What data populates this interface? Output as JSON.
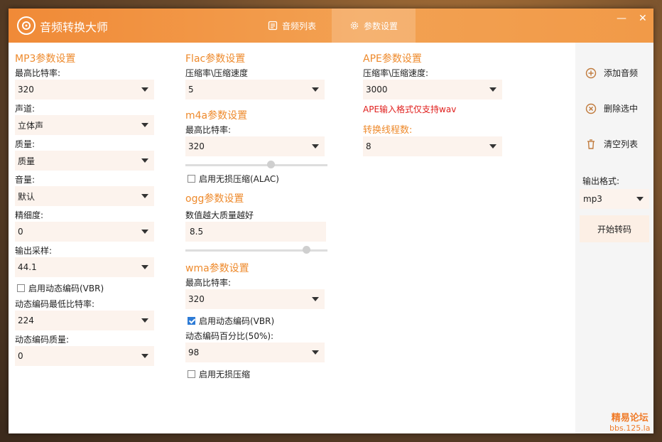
{
  "app": {
    "title": "音频转换大师",
    "close": "✕",
    "minimize": "—"
  },
  "tabs": [
    {
      "label": "音频列表",
      "icon": "list-icon"
    },
    {
      "label": "参数设置",
      "icon": "gear-icon"
    }
  ],
  "mp3": {
    "title": "MP3参数设置",
    "max_bitrate_label": "最高比特率:",
    "max_bitrate": "320",
    "channel_label": "声道:",
    "channel": "立体声",
    "quality_label": "质量:",
    "quality": "质量",
    "volume_label": "音量:",
    "volume": "默认",
    "precision_label": "精细度:",
    "precision": "0",
    "sample_label": "输出采样:",
    "sample": "44.1",
    "vbr_label": "启用动态编码(VBR)",
    "vbr_checked": false,
    "vbr_min_label": "动态编码最低比特率:",
    "vbr_min": "224",
    "vbr_quality_label": "动态编码质量:",
    "vbr_quality": "0"
  },
  "flac": {
    "title": "Flac参数设置",
    "ratio_label": "压缩率\\压缩速度",
    "ratio": "5"
  },
  "m4a": {
    "title": "m4a参数设置",
    "max_bitrate_label": "最高比特率:",
    "max_bitrate": "320",
    "slider_level": 0.6,
    "lossless_label": "启用无损压缩(ALAC)",
    "lossless_checked": false
  },
  "ogg": {
    "title": "ogg参数设置",
    "hint": "数值越大质量越好",
    "value": "8.5",
    "slider_level": 0.85
  },
  "wma": {
    "title": "wma参数设置",
    "max_bitrate_label": "最高比特率:",
    "max_bitrate": "320",
    "vbr_label": "启用动态编码(VBR)",
    "vbr_checked": true,
    "vbr_percent_label": "动态编码百分比(50%):",
    "vbr_percent": "98",
    "lossless_label": "启用无损压缩",
    "lossless_checked": false
  },
  "ape": {
    "title": "APE参数设置",
    "ratio_label": "压缩率\\压缩速度:",
    "ratio": "3000",
    "warning": "APE输入格式仅支持wav",
    "threads_label": "转换线程数:",
    "threads": "8"
  },
  "side": {
    "add": "添加音频",
    "delete": "删除选中",
    "clear": "清空列表",
    "format_label": "输出格式:",
    "format": "mp3",
    "start": "开始转码"
  },
  "watermark": {
    "line1": "精易论坛",
    "line2": "bbs.125.la"
  },
  "colors": {
    "accent": "#ee8a2c",
    "warning": "#e0201e",
    "field_bg": "#fcf3ed"
  }
}
